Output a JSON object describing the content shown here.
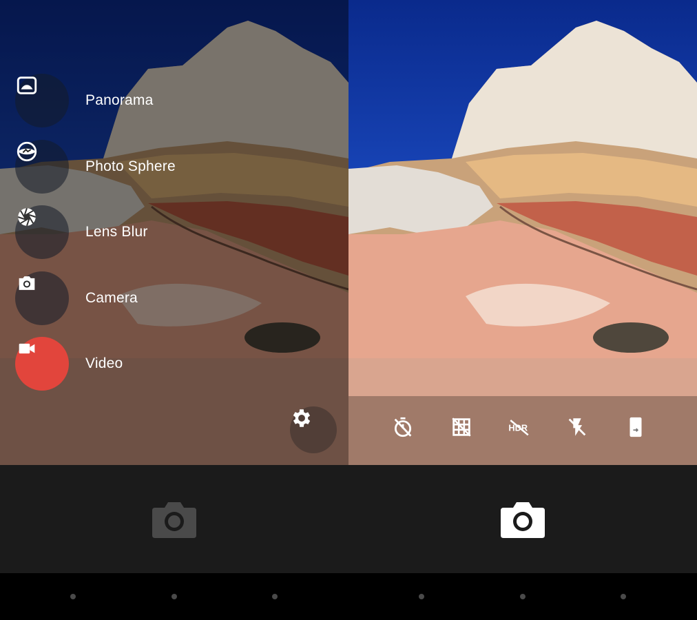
{
  "mode_drawer": {
    "modes": [
      {
        "label": "Panorama",
        "icon": "panorama-icon",
        "active": false
      },
      {
        "label": "Photo Sphere",
        "icon": "photo-sphere-icon",
        "active": false
      },
      {
        "label": "Lens Blur",
        "icon": "lens-blur-icon",
        "active": false
      },
      {
        "label": "Camera",
        "icon": "camera-icon",
        "active": false
      },
      {
        "label": "Video",
        "icon": "video-icon",
        "active": true
      }
    ],
    "settings_icon": "gear-icon"
  },
  "options_bar": {
    "items": [
      {
        "icon": "timer-off-icon"
      },
      {
        "icon": "grid-off-icon"
      },
      {
        "icon": "hdr-off-icon"
      },
      {
        "icon": "flash-off-icon"
      },
      {
        "icon": "switch-camera-icon"
      }
    ]
  },
  "shutter": {
    "left_icon": "camera-shutter-icon-disabled",
    "right_icon": "camera-shutter-icon"
  },
  "nav_bar": {
    "buttons": [
      "back-button",
      "home-button",
      "recents-button"
    ]
  },
  "colors": {
    "accent_video": "#e2453c",
    "bottom_bar": "#1b1b1b",
    "nav_bar": "#000000",
    "shutter_disabled": "#4a4a4a",
    "shutter_active": "#ffffff"
  }
}
